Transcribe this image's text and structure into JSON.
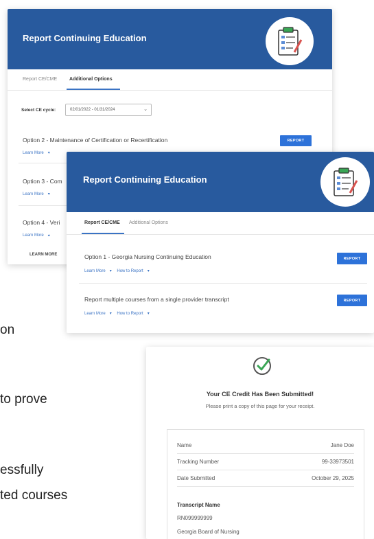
{
  "background_text": {
    "lines": [
      "on",
      "to prove",
      "essfully",
      "ted courses"
    ]
  },
  "card_back": {
    "title": "Report Continuing Education",
    "tabs": [
      "Report CE/CME",
      "Additional Options"
    ],
    "select_label": "Select CE cycle:",
    "select_value": "02/01/2022 - 01/31/2024",
    "options": [
      {
        "title": "Option 2 - Maintenance of Certification or Recertification",
        "link": "Learn More"
      },
      {
        "title": "Option 3 - Com",
        "link": "Learn More"
      },
      {
        "title": "Option 4 - Veri",
        "link": "Learn More"
      }
    ],
    "report_label": "REPORT",
    "learn_more_header": "LEARN MORE"
  },
  "card_front": {
    "title": "Report Continuing Education",
    "tabs": [
      "Report CE/CME",
      "Additional Options"
    ],
    "options": [
      {
        "title": "Option 1 - Georgia Nursing Continuing Education",
        "links": [
          "Learn More",
          "How to Report"
        ]
      },
      {
        "title": "Report multiple courses from a single provider transcript",
        "links": [
          "Learn More",
          "How to Report"
        ]
      }
    ],
    "report_label": "REPORT"
  },
  "receipt": {
    "heading": "Your CE Credit Has Been Submitted!",
    "subheading": "Please print a copy of this page for your receipt.",
    "rows": [
      {
        "label": "Name",
        "value": "Jane Doe"
      },
      {
        "label": "Tracking Number",
        "value": "99-33973501"
      },
      {
        "label": "Date Submitted",
        "value": "October 29, 2025"
      }
    ],
    "transcript_label": "Transcript Name",
    "transcript_id": "RN099999999",
    "board": "Georgia Board of Nursing"
  },
  "colors": {
    "header_blue": "#285a9e",
    "button_blue": "#2d72d9",
    "check_green": "#3aa655"
  }
}
